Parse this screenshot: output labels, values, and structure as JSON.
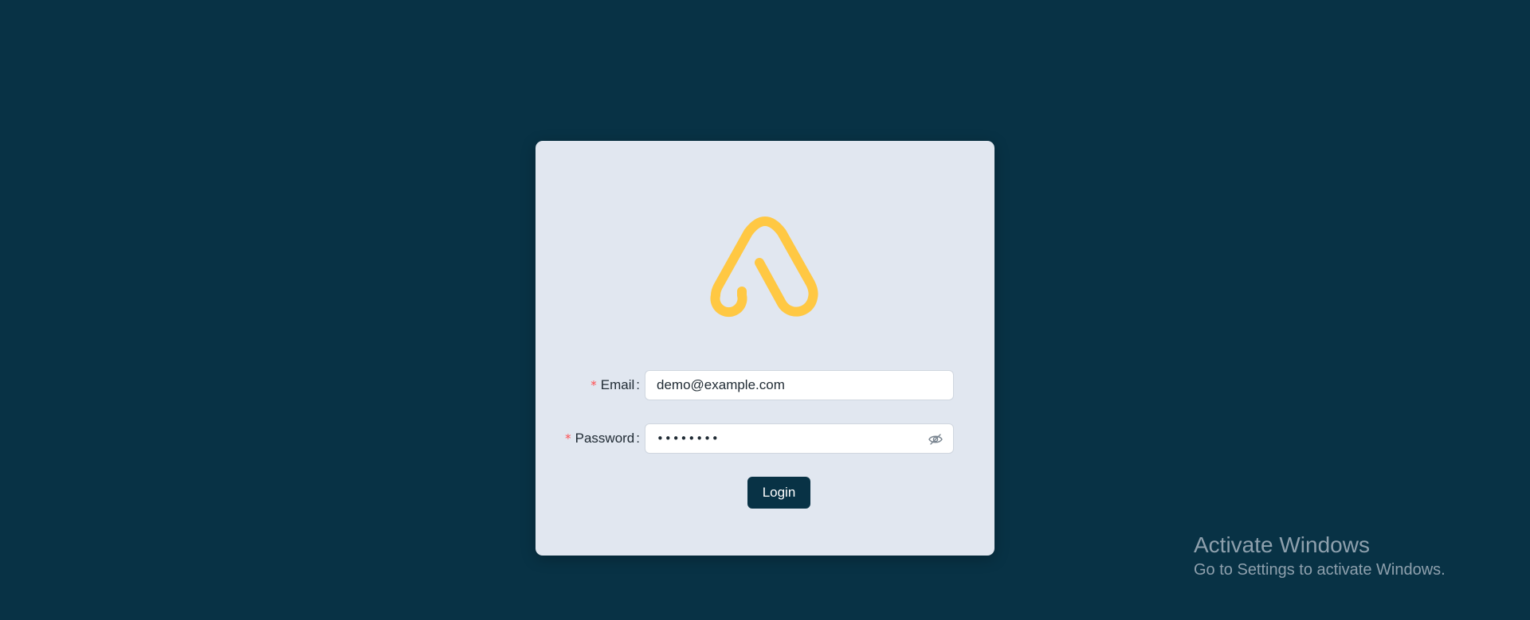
{
  "colors": {
    "background": "#083245",
    "card": "#e1e7f0",
    "logo": "#ffc843",
    "required_marker": "#ff4d4f",
    "button": "#083245"
  },
  "logo": {
    "icon": "app-logo-icon"
  },
  "form": {
    "email": {
      "required_marker": "*",
      "label": "Email",
      "colon": ":",
      "value": "demo@example.com"
    },
    "password": {
      "required_marker": "*",
      "label": "Password",
      "colon": ":",
      "value": "••••••••",
      "toggle_icon": "eye-off-icon"
    },
    "login_label": "Login"
  },
  "watermark": {
    "title": "Activate Windows",
    "subtitle": "Go to Settings to activate Windows."
  }
}
